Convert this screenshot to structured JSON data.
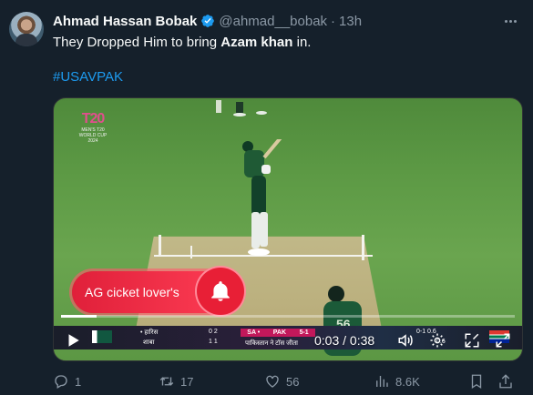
{
  "tweet": {
    "author_name": "Ahmad Hassan Bobak",
    "handle": "@ahmad__bobak",
    "separator": "·",
    "time": "13h",
    "text_prefix": "They Dropped Him to bring ",
    "text_bold": "Azam khan",
    "text_suffix": " in.",
    "hashtag": "#USAVPAK"
  },
  "video": {
    "logo_main": "T20",
    "logo_sub": "MEN'S T20 WORLD CUP 2024",
    "ad_label": "AG cicket lover's",
    "progress": 0.079,
    "time_current": "0:03",
    "time_sep": " / ",
    "time_total": "0:38",
    "scorebar": {
      "left_text": "• हारिस",
      "left_sub": "शाबा",
      "left_score_top": "0 2",
      "left_score_bot": "1 1",
      "team": "PAK",
      "team_score": "5-1",
      "prefix": "SA •",
      "sub_line": "पाकिस्तान ने टॉस जीता",
      "right_score_top": "0-1 0.6",
      "right_score_bot": "0.6"
    }
  },
  "actions": {
    "replies": "1",
    "reposts": "17",
    "likes": "56",
    "views": "8.6K"
  },
  "colors": {
    "background": "#15202b",
    "accent": "#1d9bf0",
    "muted": "#8b98a5",
    "ad_red": "#e81f36"
  }
}
